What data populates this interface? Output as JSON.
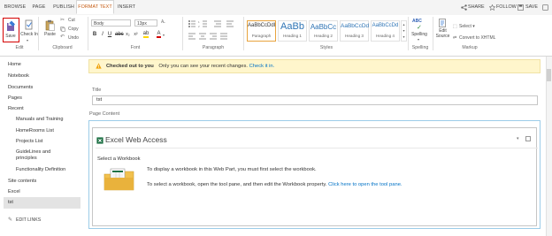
{
  "tabs": {
    "browse": "BROWSE",
    "page": "PAGE",
    "publish": "PUBLISH",
    "format_text": "FORMAT TEXT",
    "insert": "INSERT"
  },
  "top_actions": {
    "share": "SHARE",
    "follow": "FOLLOW",
    "save": "SAVE"
  },
  "ribbon": {
    "edit": {
      "save": "Save",
      "check_in": "Check In",
      "group": "Edit"
    },
    "clipboard": {
      "paste": "Paste",
      "cut": "Cut",
      "copy": "Copy",
      "undo": "Undo",
      "group": "Clipboard"
    },
    "font": {
      "family": "Body",
      "size": "13px",
      "group": "Font"
    },
    "paragraph": {
      "group": "Paragraph"
    },
    "styles": {
      "group": "Styles",
      "items": [
        {
          "sample": "AaBbCcDdI",
          "label": "Paragraph"
        },
        {
          "sample": "AaBb",
          "label": "Heading 1"
        },
        {
          "sample": "AaBbCc",
          "label": "Heading 2"
        },
        {
          "sample": "AaBbCcDd",
          "label": "Heading 3"
        },
        {
          "sample": "AaBbCcDd",
          "label": "Heading 4"
        }
      ]
    },
    "spelling": {
      "sample": "ABC",
      "label": "Spelling",
      "group": "Spelling"
    },
    "markup": {
      "edit_source": "Edit Source",
      "select": "Select",
      "convert": "Convert to XHTML",
      "group": "Markup"
    }
  },
  "nav": {
    "home": "Home",
    "notebook": "Notebook",
    "documents": "Documents",
    "pages": "Pages",
    "recent": "Recent",
    "recent_items": [
      "Manuals and Training",
      "HomeRooms List",
      "Projects List",
      "GuideLines and principles",
      "Functionality Definition"
    ],
    "site_contents": "Site contents",
    "excel": "Excel",
    "tst": "tst",
    "edit_links": "EDIT LINKS"
  },
  "status": {
    "bold": "Checked out to you",
    "message": "Only you can see your recent changes.",
    "link": "Check it in."
  },
  "form": {
    "title_label": "Title",
    "title_value": "tst",
    "content_label": "Page Content"
  },
  "webpart": {
    "title": "Excel Web Access",
    "select_label": "Select a Workbook",
    "line1": "To display a workbook in this Web Part, you must first select the workbook.",
    "line2": "To select a workbook, open the tool pane, and then edit the Workbook property.",
    "line2_link": "Click here to open the tool pane."
  },
  "colors": {
    "accent": "#c55a11",
    "link": "#0072c6",
    "status_bg": "#fff6cc",
    "highlight_border": "#d40000",
    "content_border": "#9ccce8"
  }
}
